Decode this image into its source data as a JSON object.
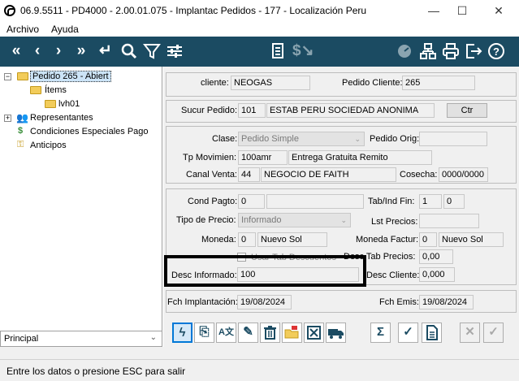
{
  "window": {
    "title": "06.9.5511 - PD4000 - 2.00.01.075 - Implantac Pedidos - 177 - Localización Peru",
    "minimize": "—",
    "maximize": "☐",
    "close": "✕"
  },
  "menu": {
    "items": [
      "Archivo",
      "Ayuda"
    ]
  },
  "toolbar": {
    "colors": {
      "background": "#1b4b62",
      "icon": "#ffffff"
    },
    "icons": [
      "double-left-icon",
      "left-icon",
      "right-icon",
      "double-right-icon",
      "enter-icon",
      "search-icon",
      "filter-icon",
      "sliders-icon",
      "report-icon",
      "price-icon",
      "gauge-icon",
      "network-icon",
      "print-icon",
      "exit-icon",
      "help-icon"
    ]
  },
  "tree": {
    "items": [
      {
        "label": "Pedido 265 - Abiert",
        "expander": "−"
      },
      {
        "label": "Ítems"
      },
      {
        "label": "lvh01"
      },
      {
        "label": "Representantes",
        "expander": "+"
      },
      {
        "label": "Condiciones Especiales Pago"
      },
      {
        "label": "Anticipos"
      }
    ],
    "combo_value": "Principal"
  },
  "form": {
    "cliente_label": "cliente:",
    "cliente_value": "NEOGAS",
    "pedido_cliente_label": "Pedido Cliente:",
    "pedido_cliente_value": "265",
    "sucur_label": "Sucur Pedido:",
    "sucur_code": "101",
    "sucur_name": "ESTAB PERU SOCIEDAD ANONIMA",
    "ctr_button": "Ctr",
    "clase_label": "Clase:",
    "clase_value": "Pedido Simple",
    "pedido_orig_label": "Pedido Orig:",
    "pedido_orig_value": "",
    "tp_mov_label": "Tp Movimien:",
    "tp_mov_code": "100amr",
    "tp_mov_name": "Entrega Gratuita Remito",
    "canal_label": "Canal Venta:",
    "canal_code": "44",
    "canal_name": "NEGOCIO DE FAITH",
    "cosecha_label": "Cosecha:",
    "cosecha_value": "0000/0000",
    "cond_pagto_label": "Cond Pagto:",
    "cond_pagto_code": "0",
    "cond_pagto_name": "",
    "tab_ind_label": "Tab/Ind Fin:",
    "tab_ind_1": "1",
    "tab_ind_2": "0",
    "tipo_precio_label": "Tipo de Precio:",
    "tipo_precio_value": "Informado",
    "lst_precios_label": "Lst Precios:",
    "lst_precios_value": "",
    "moneda_label": "Moneda:",
    "moneda_code": "0",
    "moneda_name": "Nuevo Sol",
    "moneda_fact_label": "Moneda Factur:",
    "moneda_fact_code": "0",
    "moneda_fact_name": "Nuevo Sol",
    "usar_tab_label": "Usar Tab Descuentos",
    "desc_tab_label": "Desc Tab Precios:",
    "desc_tab_value": "0,00",
    "desc_inf_label": "Desc Informado:",
    "desc_inf_value": "100",
    "desc_cliente_label": "Desc Cliente:",
    "desc_cliente_value": "0,000",
    "fch_impl_label": "Fch Implantación:",
    "fch_impl_value": "19/08/2024",
    "fch_emis_label": "Fch Emis:",
    "fch_emis_value": "19/08/2024"
  },
  "actions": {
    "icons": [
      "lightning-icon",
      "copy-doc-icon",
      "translate-doc-icon",
      "edit-doc-icon",
      "trash-icon",
      "open-folder-icon",
      "cancel-box-icon",
      "truck-icon",
      "sum-icon",
      "check-icon",
      "document-icon",
      "cancel-icon",
      "confirm-icon"
    ]
  },
  "status": {
    "text": "Entre los datos o presione ESC para salir"
  }
}
